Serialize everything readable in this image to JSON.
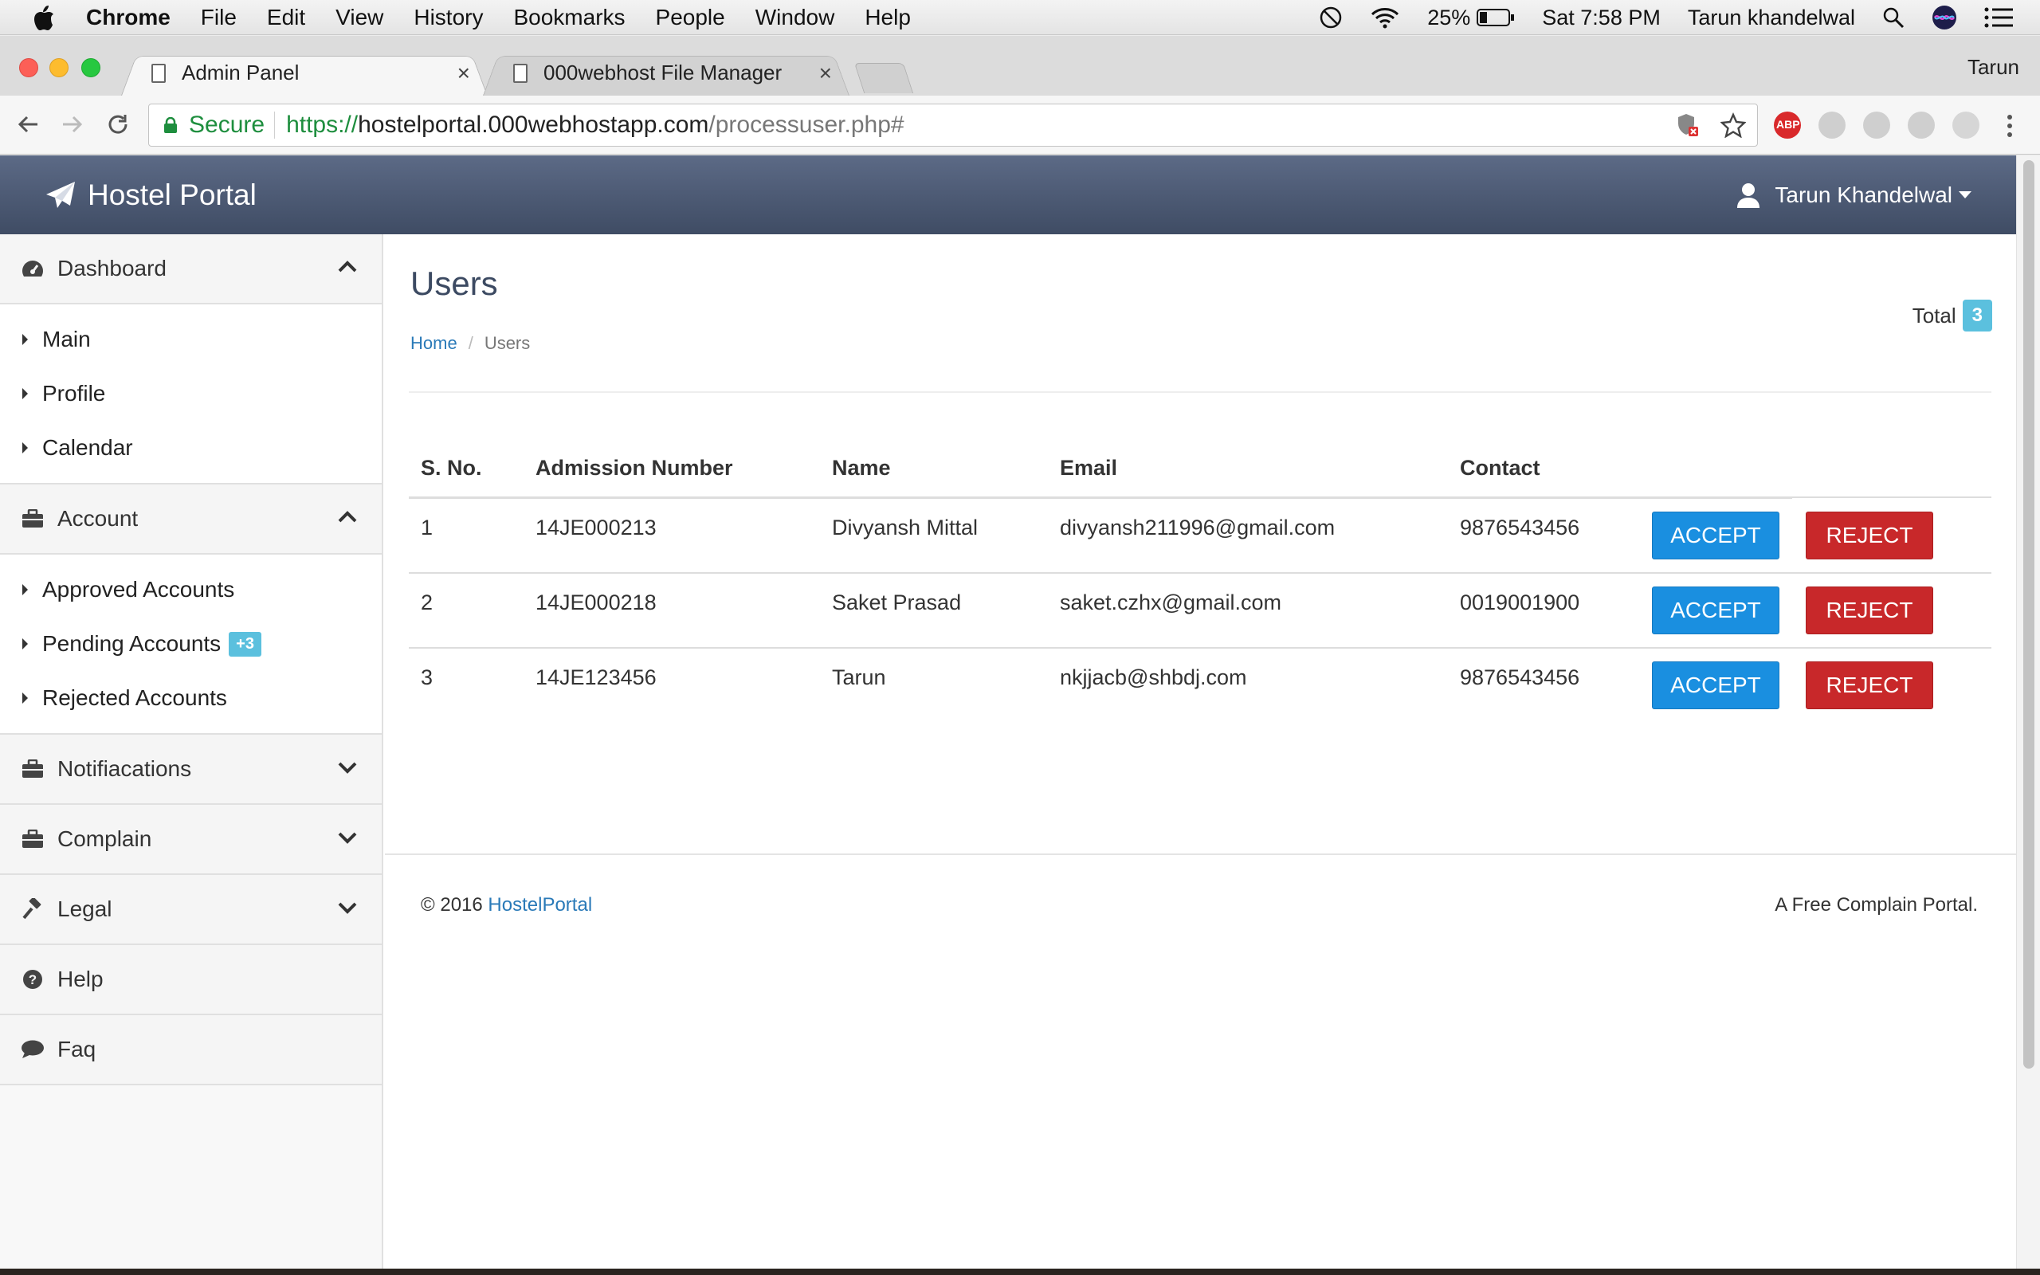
{
  "menubar": {
    "app": "Chrome",
    "items": [
      "File",
      "Edit",
      "View",
      "History",
      "Bookmarks",
      "People",
      "Window",
      "Help"
    ],
    "battery": "25%",
    "clock": "Sat 7:58 PM",
    "user": "Tarun khandelwal"
  },
  "tabs": [
    {
      "title": "Admin Panel",
      "close": "×"
    },
    {
      "title": "000webhost File Manager",
      "close": "×"
    }
  ],
  "profile": "Tarun",
  "omnibox": {
    "secure_label": "Secure",
    "scheme": "https://",
    "host": "hostelportal.000webhostapp.com",
    "path": "/processuser.php#"
  },
  "navbar": {
    "brand": "Hostel Portal",
    "user": "Tarun Khandelwal"
  },
  "sidebar": {
    "dashboard": {
      "label": "Dashboard",
      "items": [
        "Main",
        "Profile",
        "Calendar"
      ]
    },
    "account": {
      "label": "Account",
      "items": [
        "Approved Accounts",
        "Pending Accounts",
        "Rejected Accounts"
      ],
      "pending_badge": "+3"
    },
    "notifications": "Notifiacations",
    "complain": "Complain",
    "legal": "Legal",
    "help": "Help",
    "faq": "Faq"
  },
  "page": {
    "title": "Users",
    "breadcrumb": {
      "home": "Home",
      "divider": "/",
      "current": "Users"
    },
    "total_label": "Total",
    "total_count": "3"
  },
  "table": {
    "headers": [
      "S. No.",
      "Admission Number",
      "Name",
      "Email",
      "Contact"
    ],
    "rows": [
      {
        "sno": "1",
        "admission": "14JE000213",
        "name": "Divyansh Mittal",
        "email": "divyansh211996@gmail.com",
        "contact": "9876543456"
      },
      {
        "sno": "2",
        "admission": "14JE000218",
        "name": "Saket Prasad",
        "email": "saket.czhx@gmail.com",
        "contact": "0019001900"
      },
      {
        "sno": "3",
        "admission": "14JE123456",
        "name": "Tarun",
        "email": "nkjjacb@shbdj.com",
        "contact": "9876543456"
      }
    ],
    "accept_label": "ACCEPT",
    "reject_label": "REJECT"
  },
  "footer": {
    "copyright": "© 2016 ",
    "link": "HostelPortal",
    "tagline": "A Free Complain Portal."
  },
  "colors": {
    "navbar": "#4e5b75",
    "accept": "#1a8fe0",
    "reject": "#c8282a",
    "badge": "#5bc0de",
    "link": "#2a7ab8"
  }
}
